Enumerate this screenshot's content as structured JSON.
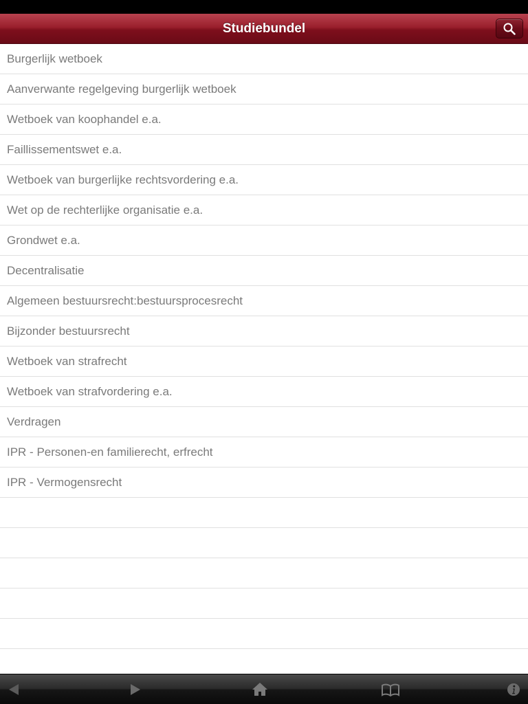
{
  "nav": {
    "title": "Studiebundel"
  },
  "list": {
    "items": [
      "Burgerlijk wetboek",
      "Aanverwante regelgeving burgerlijk wetboek",
      "Wetboek van koophandel e.a.",
      "Faillissementswet e.a.",
      "Wetboek van burgerlijke rechtsvordering e.a.",
      "Wet op de rechterlijke organisatie e.a.",
      "Grondwet e.a.",
      "Decentralisatie",
      "Algemeen bestuursrecht:bestuursprocesrecht",
      "Bijzonder bestuursrecht",
      "Wetboek van strafrecht",
      "Wetboek van strafvordering e.a.",
      "Verdragen",
      "IPR - Personen-en familierecht, erfrecht",
      "IPR - Vermogensrecht"
    ]
  },
  "toolbar": {
    "icons": [
      "back-arrow-icon",
      "forward-arrow-icon",
      "home-icon",
      "book-icon",
      "info-icon"
    ]
  },
  "colors": {
    "nav_bar": "#9a1f2c",
    "row_text": "#7a7a7a",
    "separator": "#e0e0e0",
    "toolbar": "#1a1a1a"
  }
}
